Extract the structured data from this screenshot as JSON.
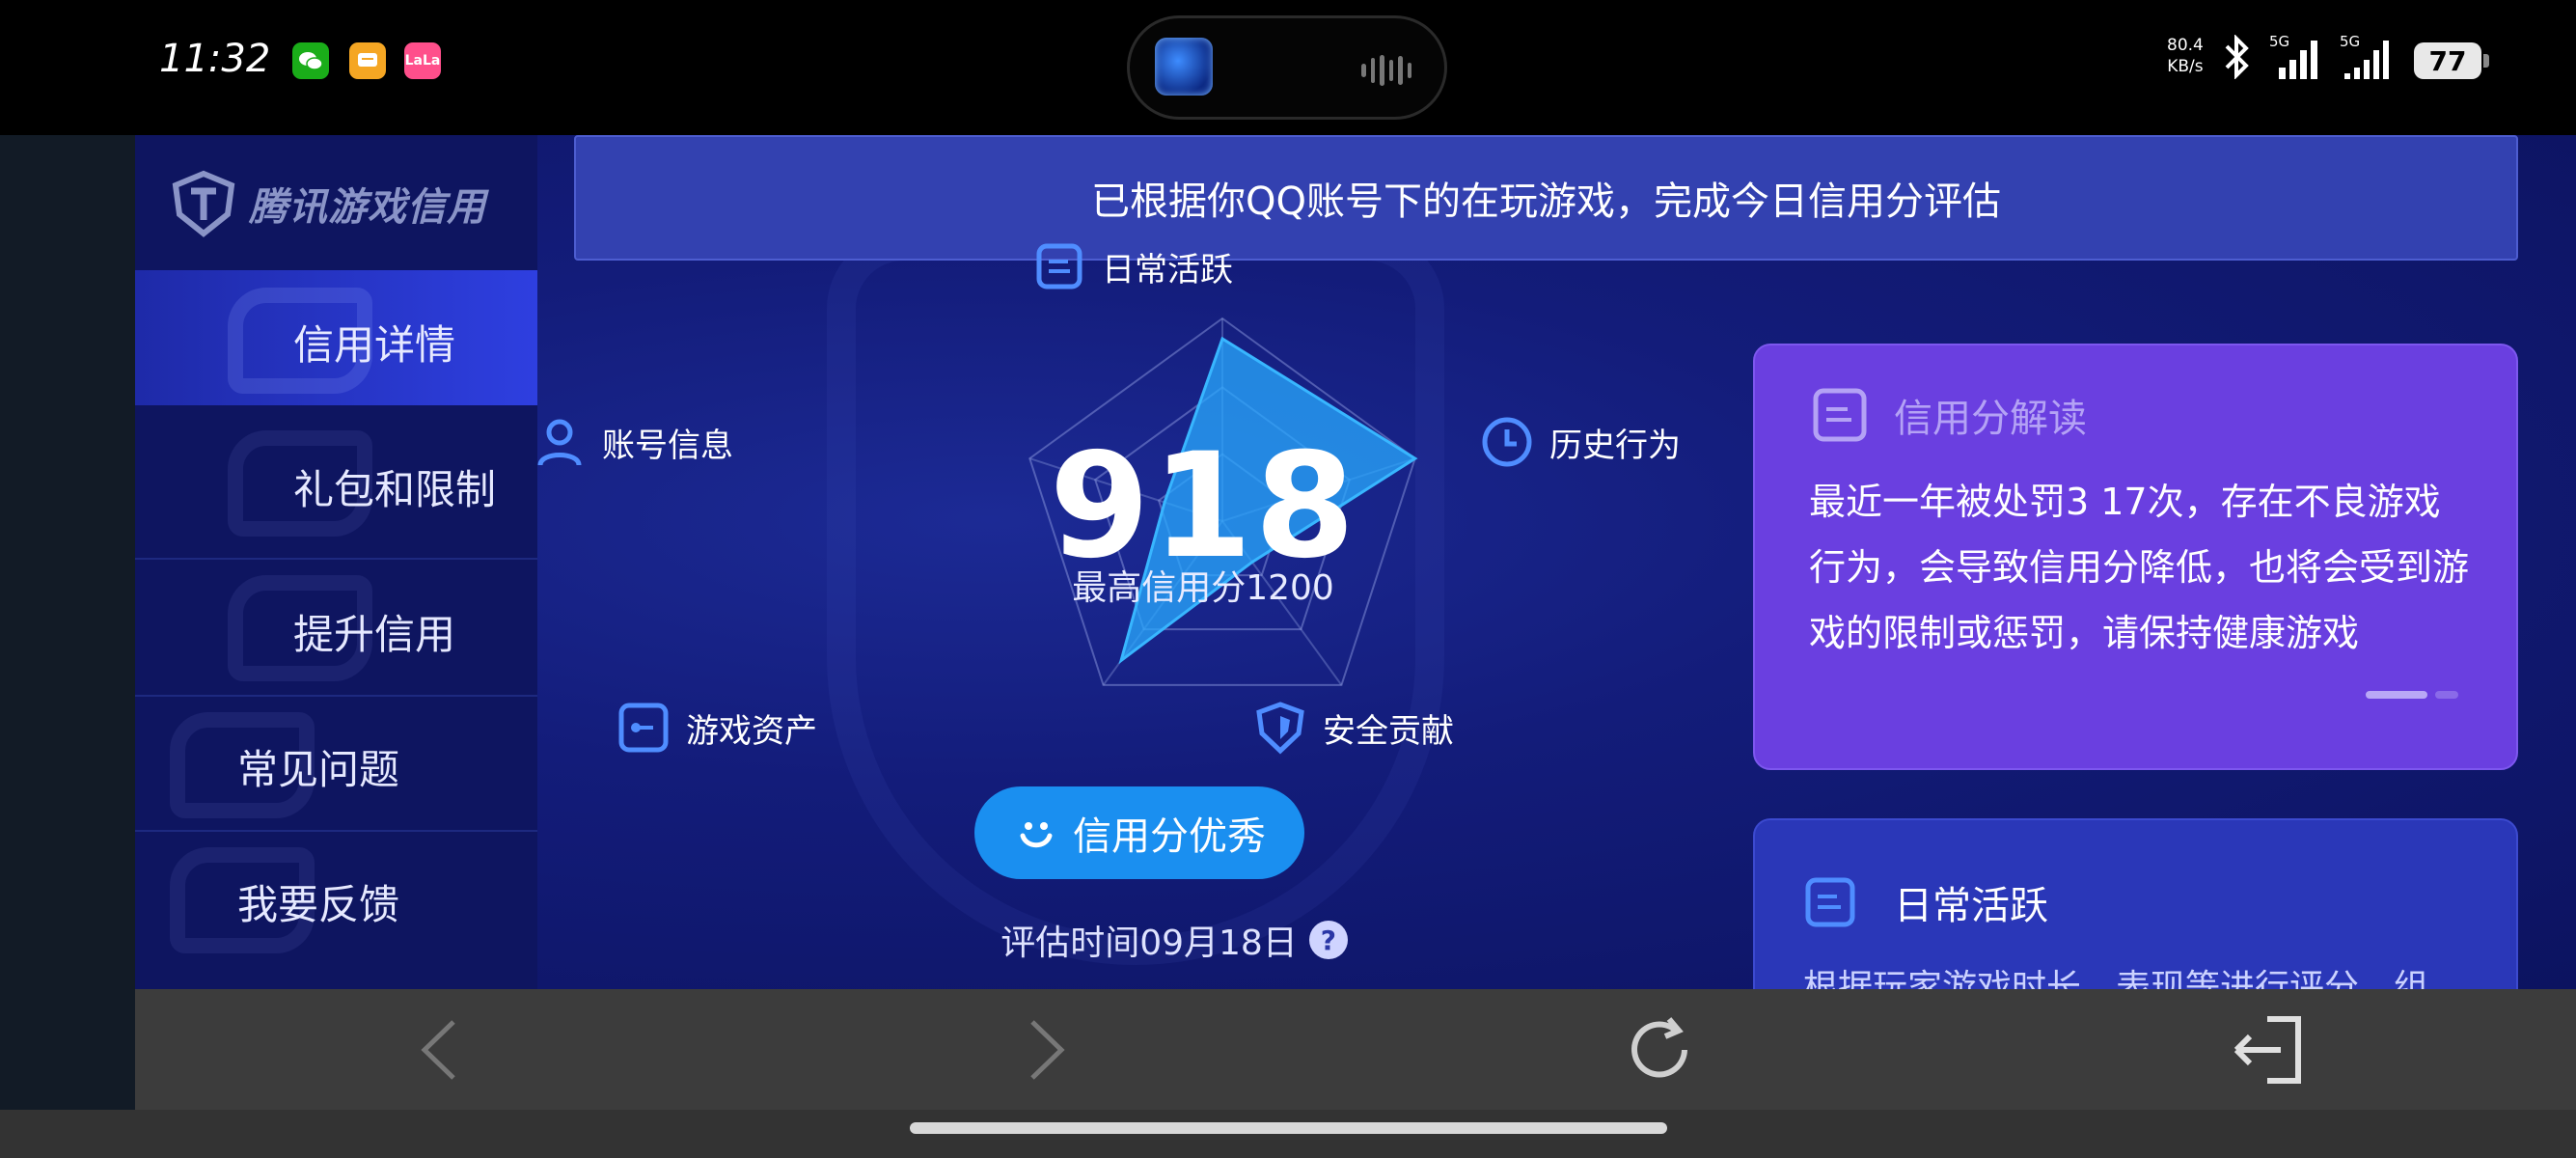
{
  "status_bar": {
    "time": "11:32",
    "apps": [
      {
        "name": "wechat-icon",
        "color": "#1aad19"
      },
      {
        "name": "message-icon",
        "color": "#f5a623"
      },
      {
        "name": "qq-music-icon",
        "color": "#ff4f8b",
        "text": "LaLa"
      }
    ],
    "net_speed": "80.4",
    "net_unit": "KB/s",
    "signal1": "5G",
    "signal2": "5G",
    "battery": "77"
  },
  "app": {
    "brand": "腾讯游戏信用",
    "banner": "已根据你QQ账号下的在玩游戏，完成今日信用分评估",
    "sidebar": [
      {
        "label": "信用详情",
        "active": true
      },
      {
        "label": "礼包和限制",
        "active": false
      },
      {
        "label": "提升信用",
        "active": false
      },
      {
        "label": "常见问题",
        "active": false
      },
      {
        "label": "我要反馈",
        "active": false
      }
    ],
    "score": {
      "value": "918",
      "max_label": "最高信用分1200",
      "level": "信用分优秀",
      "eval_time": "评估时间09月18日",
      "help": "?"
    },
    "axes": {
      "top": "日常活跃",
      "right": "历史行为",
      "bottom_right": "安全贡献",
      "bottom_left": "游戏资产",
      "left": "账号信息"
    },
    "radar_levels": {
      "daily_activity": 0.9,
      "history": 1.0,
      "security": 0.25,
      "assets": 0.85,
      "account": 0.3
    },
    "interpretation": {
      "title": "信用分解读",
      "body": "最近一年被处罚3 17次，存在不良游戏行为，会导致信用分降低，也将会受到游戏的限制或惩罚，请保持健康游戏"
    },
    "daily_card": {
      "title": "日常活跃",
      "body": "根据玩家游戏时长、表现等进行评分，组"
    }
  },
  "colors": {
    "accent": "#1a8ff0",
    "card_purple": "#6a3fe0",
    "banner": "#3341b0"
  }
}
